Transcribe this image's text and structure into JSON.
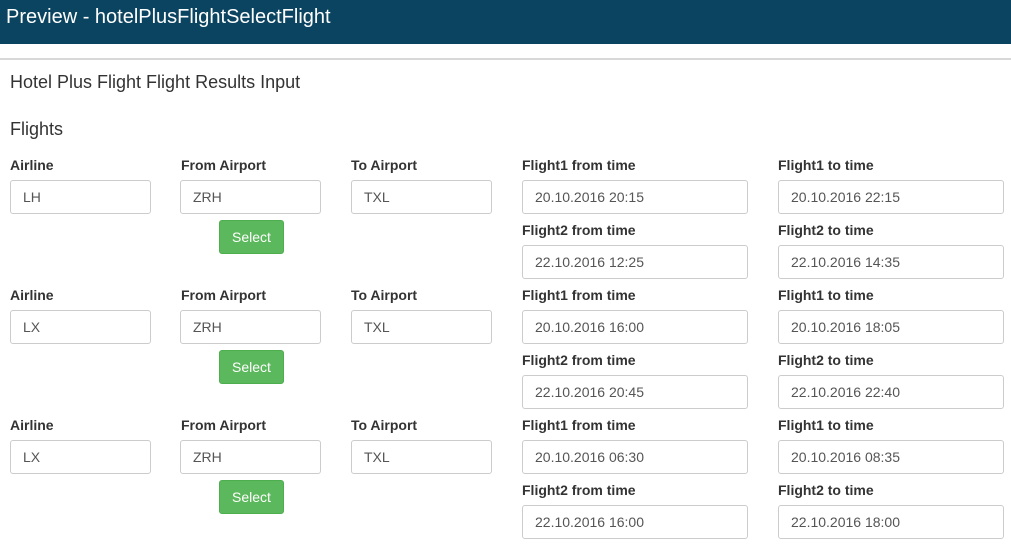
{
  "window": {
    "title": "Preview - hotelPlusFlightSelectFlight"
  },
  "page": {
    "title": "Hotel Plus Flight Flight Results Input",
    "section": "Flights"
  },
  "labels": {
    "airline": "Airline",
    "from_airport": "From Airport",
    "to_airport": "To Airport",
    "flight1_from": "Flight1 from time",
    "flight1_to": "Flight1 to time",
    "flight2_from": "Flight2 from time",
    "flight2_to": "Flight2 to time",
    "select": "Select"
  },
  "flights": [
    {
      "airline": "LH",
      "from": "ZRH",
      "to": "TXL",
      "f1_from": "20.10.2016 20:15",
      "f1_to": "20.10.2016 22:15",
      "f2_from": "22.10.2016 12:25",
      "f2_to": "22.10.2016 14:35"
    },
    {
      "airline": "LX",
      "from": "ZRH",
      "to": "TXL",
      "f1_from": "20.10.2016 16:00",
      "f1_to": "20.10.2016 18:05",
      "f2_from": "22.10.2016 20:45",
      "f2_to": "22.10.2016 22:40"
    },
    {
      "airline": "LX",
      "from": "ZRH",
      "to": "TXL",
      "f1_from": "20.10.2016 06:30",
      "f1_to": "20.10.2016 08:35",
      "f2_from": "22.10.2016 16:00",
      "f2_to": "22.10.2016 18:00"
    }
  ]
}
